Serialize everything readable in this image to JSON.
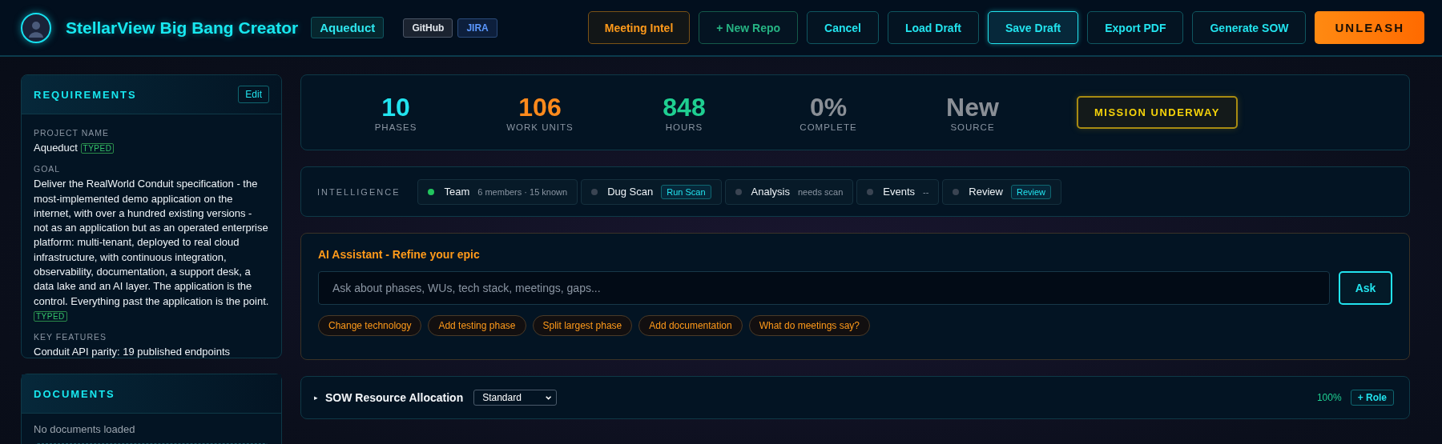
{
  "header": {
    "title": "StellarView Big Bang Creator",
    "project_badge": "Aqueduct",
    "integrations": [
      {
        "label": "GitHub",
        "kind": "github"
      },
      {
        "label": "JIRA",
        "kind": "jira"
      }
    ],
    "buttons": [
      {
        "label": "Meeting Intel",
        "kind": "amber"
      },
      {
        "label": "+ New Repo",
        "kind": "green"
      },
      {
        "label": "Cancel",
        "kind": "cyan"
      },
      {
        "label": "Load Draft",
        "kind": "cyan"
      },
      {
        "label": "Save Draft",
        "kind": "cyan-strong"
      },
      {
        "label": "Export PDF",
        "kind": "cyan"
      },
      {
        "label": "Generate SOW",
        "kind": "cyan"
      },
      {
        "label": "UNLEASH",
        "kind": "primary"
      }
    ]
  },
  "requirements": {
    "title": "REQUIREMENTS",
    "edit_button": "Edit",
    "fields": [
      {
        "label": "PROJECT NAME",
        "value": "Aqueduct",
        "badge": "TYPED"
      },
      {
        "label": "GOAL",
        "value": "Deliver the RealWorld Conduit specification - the most-implemented demo application on the internet, with over a hundred existing versions - not as an application but as an operated enterprise platform: multi-tenant, deployed to real cloud infrastructure, with continuous integration, observability, documentation, a support desk, a data lake and an AI layer. The application is the control. Everything past the application is the point.",
        "badge": "TYPED"
      },
      {
        "label": "KEY FEATURES",
        "value": "Conduit API parity: 19 published endpoints"
      }
    ]
  },
  "documents": {
    "title": "DOCUMENTS",
    "empty_text": "No documents loaded"
  },
  "stats": [
    {
      "value": "10",
      "label": "PHASES",
      "color": "#22e3ee"
    },
    {
      "value": "106",
      "label": "WORK UNITS",
      "color": "#ff8a1c"
    },
    {
      "value": "848",
      "label": "HOURS",
      "color": "#1fcf91"
    },
    {
      "value": "0%",
      "label": "COMPLETE",
      "color": "#8a8f96"
    },
    {
      "value": "New",
      "label": "SOURCE",
      "color": "#8a8f96"
    }
  ],
  "mission_button": "MISSION UNDERWAY",
  "intelligence": {
    "label": "INTELLIGENCE",
    "items": [
      {
        "name": "Team",
        "kind": "text",
        "detail": "6 members · 15 known",
        "color": "#22c55e"
      },
      {
        "name": "Dug Scan",
        "kind": "action",
        "detail": "Run Scan",
        "color": "#3a4452"
      },
      {
        "name": "Analysis",
        "kind": "text",
        "detail": "needs scan",
        "color": "#3a4452"
      },
      {
        "name": "Events",
        "kind": "text",
        "detail": "--",
        "color": "#3a4452"
      },
      {
        "name": "Review",
        "kind": "action",
        "detail": "Review",
        "color": "#3a4452"
      }
    ]
  },
  "assistant": {
    "title": "AI Assistant - Refine your epic",
    "placeholder": "Ask about phases, WUs, tech stack, meetings, gaps...",
    "ask_button": "Ask",
    "suggestions": [
      "Change technology",
      "Add testing phase",
      "Split largest phase",
      "Add documentation",
      "What do meetings say?"
    ]
  },
  "sow": {
    "toggle": "▸",
    "title": "SOW Resource Allocation",
    "expanded": false,
    "select_value": "Standard",
    "percent": "100%",
    "add_role_button": "+ Role"
  }
}
